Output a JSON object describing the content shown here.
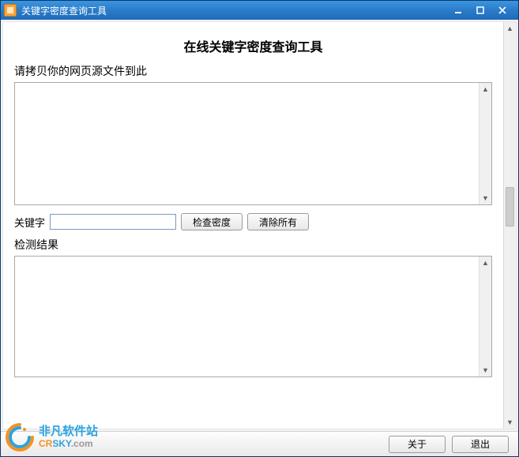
{
  "window": {
    "title": "关键字密度查询工具"
  },
  "heading": "在线关键字密度查询工具",
  "labels": {
    "source_prompt": "请拷贝你的网页源文件到此",
    "keyword": "关键字",
    "result": "检测结果"
  },
  "inputs": {
    "source_value": "",
    "keyword_value": "",
    "result_value": ""
  },
  "buttons": {
    "check": "检查密度",
    "clear": "清除所有",
    "about": "关于",
    "exit": "退出"
  },
  "watermark": {
    "cn": "非凡软件站",
    "en_a": "CR",
    "en_b": "SKY",
    "en_c": ".com"
  }
}
